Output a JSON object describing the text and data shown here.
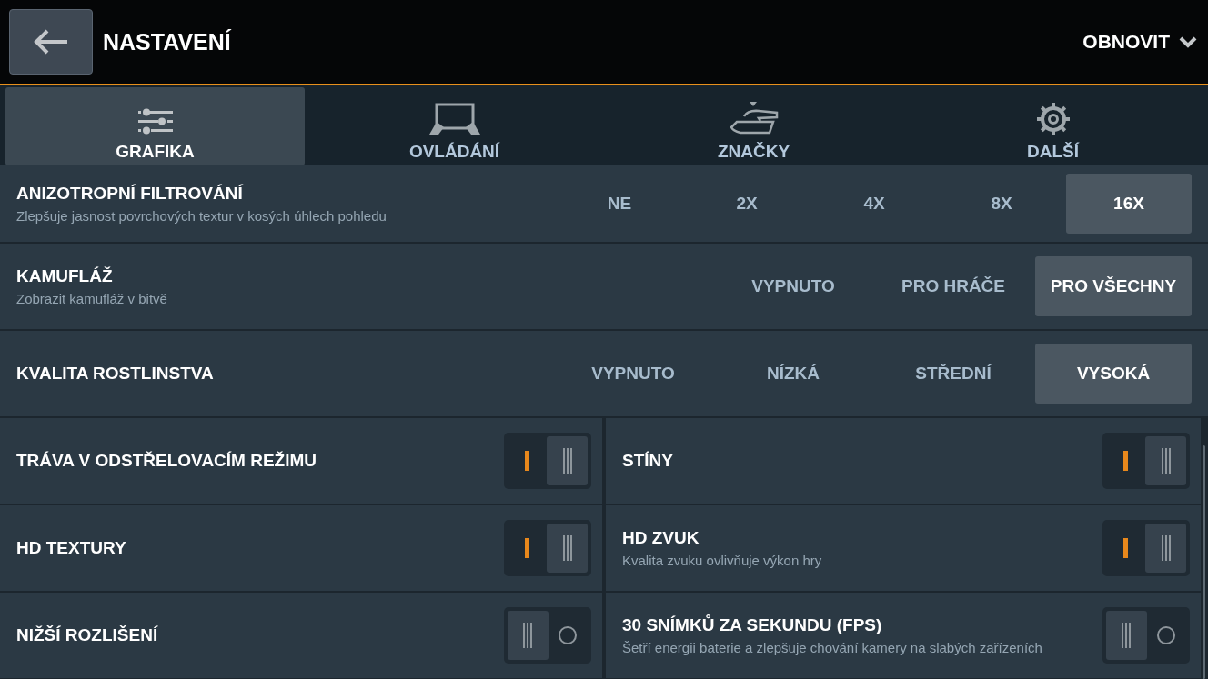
{
  "header": {
    "title": "NASTAVENÍ",
    "reset": "OBNOVIT"
  },
  "tabs": [
    {
      "label": "GRAFIKA",
      "kind": "sliders",
      "selected": true
    },
    {
      "label": "OVLÁDÁNÍ",
      "kind": "tablet",
      "selected": false
    },
    {
      "label": "ZNAČKY",
      "kind": "tank",
      "selected": false
    },
    {
      "label": "DALŠÍ",
      "kind": "gear",
      "selected": false
    }
  ],
  "option_rows": [
    {
      "title": "ANIZOTROPNÍ FILTROVÁNÍ",
      "description": "Zlepšuje jasnost povrchových textur v kosých úhlech pohledu",
      "options": [
        {
          "label": "NE",
          "selected": false
        },
        {
          "label": "2X",
          "selected": false
        },
        {
          "label": "4X",
          "selected": false
        },
        {
          "label": "8X",
          "selected": false
        },
        {
          "label": "16X",
          "selected": true
        }
      ]
    },
    {
      "title": "KAMUFLÁŽ",
      "description": "Zobrazit kamufláž v bitvě",
      "options": [
        {
          "label": "VYPNUTO",
          "selected": false
        },
        {
          "label": "PRO HRÁČE",
          "selected": false
        },
        {
          "label": "PRO VŠECHNY",
          "selected": true
        }
      ]
    },
    {
      "title": "KVALITA ROSTLINSTVA",
      "options": [
        {
          "label": "VYPNUTO",
          "selected": false
        },
        {
          "label": "NÍZKÁ",
          "selected": false
        },
        {
          "label": "STŘEDNÍ",
          "selected": false
        },
        {
          "label": "VYSOKÁ",
          "selected": true
        }
      ]
    }
  ],
  "toggle_rows": [
    {
      "toggles": [
        {
          "title": "TRÁVA V ODSTŘELOVACÍM REŽIMU",
          "on": true
        },
        {
          "title": "STÍNY",
          "on": true
        }
      ]
    },
    {
      "toggles": [
        {
          "title": "HD TEXTURY",
          "on": true
        },
        {
          "title": "HD ZVUK",
          "description": "Kvalita zvuku ovlivňuje výkon hry",
          "on": true
        }
      ]
    },
    {
      "toggles": [
        {
          "title": "NIŽŠÍ ROZLIŠENÍ",
          "on": false
        },
        {
          "title": "30 SNÍMKŮ ZA SEKUNDU (FPS)",
          "description": "Šetří energii baterie a zlepšuje chování kamery na slabých zařízeních",
          "on": false
        }
      ]
    }
  ]
}
